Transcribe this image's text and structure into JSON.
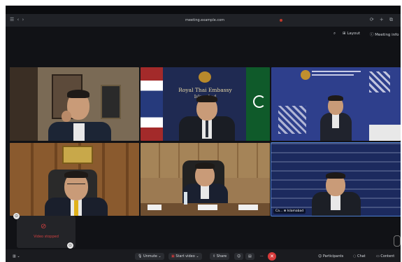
{
  "browser": {
    "url": "meeting.example.com",
    "left_controls": "☰ ‹ ›",
    "right_controls": "⟳ + ⧉"
  },
  "meeting": {
    "layout_label": "Layout",
    "info_label": "Meeting info",
    "search_icon": "search-icon"
  },
  "tiles": [
    {
      "id": "participant-1",
      "name": ""
    },
    {
      "id": "participant-2",
      "name": ""
    },
    {
      "id": "participant-3",
      "name": ""
    },
    {
      "id": "participant-4",
      "name": ""
    },
    {
      "id": "participant-5",
      "name": ""
    },
    {
      "id": "participant-6",
      "name": "Ca... ⊕ Islamabad"
    }
  ],
  "embassy_banner": {
    "line1": "Royal Thai Embassy",
    "line2": "Islamabad"
  },
  "self_view": {
    "label": "Video stopped"
  },
  "toolbar": {
    "unmute": "Unmute",
    "start_video": "Start video",
    "share": "Share",
    "participants": "Participants",
    "chat": "Chat",
    "content": "Content"
  },
  "colors": {
    "accent_red": "#d83b3b",
    "background": "#111216",
    "toolbar": "#1a1b1f"
  }
}
